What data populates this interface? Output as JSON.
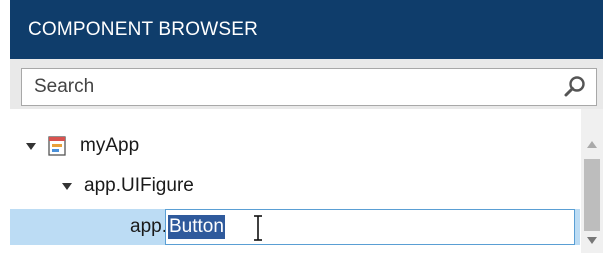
{
  "header": {
    "title": "COMPONENT BROWSER"
  },
  "search": {
    "placeholder": "Search"
  },
  "tree": {
    "root_label": "myApp",
    "child_label": "app.UIFigure",
    "editing_prefix": "app.",
    "editing_selected": "Button"
  },
  "icons": {
    "search": "search-icon",
    "app": "app-file-icon",
    "expand": "caret-down-icon",
    "cursor": "text-cursor-icon"
  },
  "colors": {
    "header_bg": "#0f3d6b",
    "selected_row": "#bcdcf4",
    "text_selection": "#2f5a9c"
  }
}
